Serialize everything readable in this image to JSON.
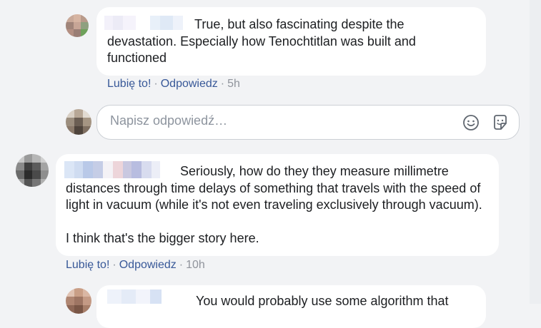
{
  "comments": [
    {
      "text": "True, but also fascinating despite the devastation. Especially how Tenochtitlan was built and functioned",
      "like_label": "Lubię to!",
      "reply_label": "Odpowiedz",
      "time": "5h"
    },
    {
      "text": "Seriously, how do they they measure millimetre distances through time delays of something that travels with the speed of light in vacuum (while it's not even traveling exclusively through vacuum).",
      "text2": "I think that's the bigger story here.",
      "like_label": "Lubię to!",
      "reply_label": "Odpowiedz",
      "time": "10h"
    },
    {
      "text": "You would probably use some algorithm that"
    }
  ],
  "reply": {
    "placeholder": "Napisz odpowiedź…",
    "emoji_icon": "emoji-icon",
    "sticker_icon": "sticker-icon"
  },
  "separator": "·",
  "colors": {
    "background": "#f2f3f5",
    "bubble": "#ffffff",
    "link": "#385898",
    "meta": "#90949c"
  }
}
